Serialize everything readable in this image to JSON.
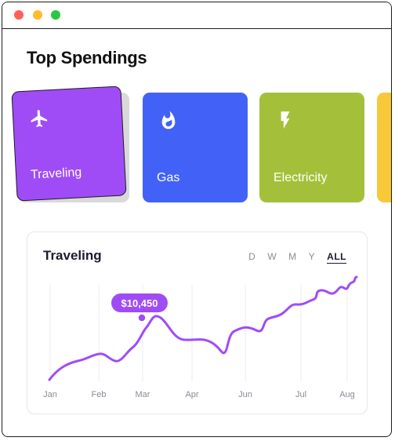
{
  "window": {
    "controls": [
      "close",
      "minimize",
      "maximize"
    ]
  },
  "heading": "Top Spendings",
  "cards": [
    {
      "label": "Traveling",
      "icon": "airplane-icon",
      "color": "#9f4cf7",
      "selected": true
    },
    {
      "label": "Gas",
      "icon": "flame-icon",
      "color": "#4262f7",
      "selected": false
    },
    {
      "label": "Electricity",
      "icon": "lightning-bolt-icon",
      "color": "#a4c03a",
      "selected": false
    }
  ],
  "partial_card_color": "#f7c93a",
  "chart": {
    "title": "Traveling",
    "ranges": [
      "D",
      "W",
      "M",
      "Y",
      "ALL"
    ],
    "active_range": "ALL"
  },
  "chart_data": {
    "type": "line",
    "title": "Traveling",
    "x": [
      "Jan",
      "Feb",
      "Mar",
      "Apr",
      "Jun",
      "Jul",
      "Aug"
    ],
    "xlabel": "",
    "ylabel": "",
    "grid": "vertical",
    "line_color": "#9f4cf7",
    "highlight": {
      "x": "Mar",
      "label": "$10,450"
    }
  }
}
